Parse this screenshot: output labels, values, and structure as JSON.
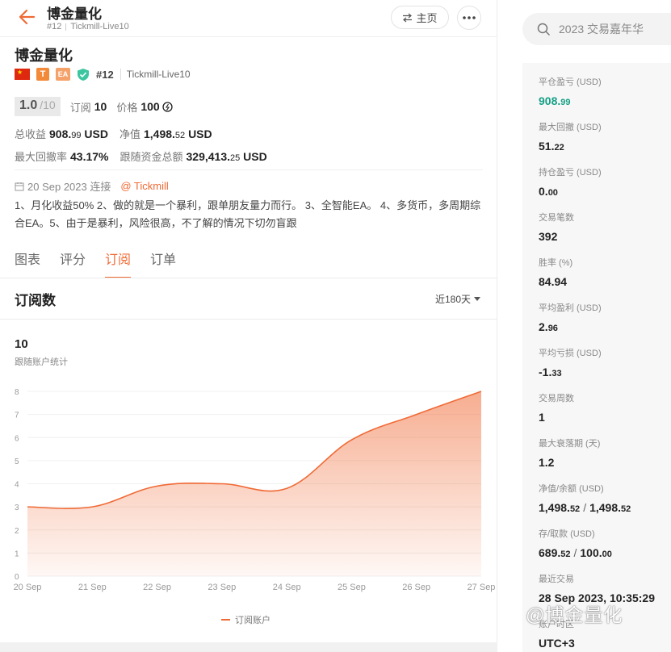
{
  "header": {
    "title": "博金量化",
    "rank": "#12",
    "server": "Tickmill-Live10",
    "home_label": "主页"
  },
  "profile": {
    "name": "博金量化",
    "flag_glyph": "★",
    "badge_t": "T",
    "badge_ea": "EA",
    "rank": "#12",
    "server": "Tickmill-Live10",
    "rating": "1.0",
    "rating_max": "/10",
    "subscribe_label": "订阅",
    "subscribe_count": "10",
    "price_label": "价格",
    "price_value": "100",
    "total_profit_label": "总收益",
    "total_profit_int": "908.",
    "total_profit_dec": "99",
    "total_profit_unit": "USD",
    "equity_label": "净值",
    "equity_int": "1,498.",
    "equity_dec": "52",
    "equity_unit": "USD",
    "max_drawdown_label": "最大回撤率",
    "max_drawdown_value": "43.17%",
    "follow_funds_label": "跟随资金总额",
    "follow_funds_int": "329,413.",
    "follow_funds_dec": "25",
    "follow_funds_unit": "USD",
    "connect_date": "20 Sep 2023 连接",
    "connect_broker": "@ Tickmill",
    "description": "1、月化收益50% 2、做的就是一个暴利，跟单朋友量力而行。 3、全智能EA。 4、多货币，多周期综合EA。5、由于是暴利，风险很高，不了解的情况下切勿盲跟"
  },
  "tabs": [
    {
      "label": "图表",
      "active": false
    },
    {
      "label": "评分",
      "active": false
    },
    {
      "label": "订阅",
      "active": true
    },
    {
      "label": "订单",
      "active": false
    }
  ],
  "subscriptions": {
    "title": "订阅数",
    "range": "近180天",
    "current_count": "10",
    "current_label": "跟随账户统计",
    "legend": "订阅账户"
  },
  "chart_data": {
    "type": "area",
    "x": [
      "20 Sep",
      "21 Sep",
      "22 Sep",
      "23 Sep",
      "24 Sep",
      "25 Sep",
      "26 Sep",
      "27 Sep"
    ],
    "series": [
      {
        "name": "订阅账户",
        "values": [
          3,
          3,
          3.9,
          4,
          3.8,
          5.9,
          7,
          8
        ]
      }
    ],
    "yticks": [
      0,
      1,
      2,
      3,
      4,
      5,
      6,
      7,
      8
    ],
    "ylim": [
      0,
      8
    ],
    "grid": true,
    "legend_position": "bottom",
    "color": "#f06a35"
  },
  "search": {
    "placeholder": "2023 交易嘉年华"
  },
  "metrics": [
    {
      "label": "平仓盈亏 (USD)",
      "int": "908.",
      "dec": "99",
      "green": true
    },
    {
      "label": "最大回撤 (USD)",
      "int": "51.",
      "dec": "22"
    },
    {
      "label": "持仓盈亏 (USD)",
      "int": "0.",
      "dec": "00"
    },
    {
      "label": "交易笔数",
      "int": "392",
      "dec": ""
    },
    {
      "label": "胜率 (%)",
      "int": "84.94",
      "dec": ""
    },
    {
      "label": "平均盈利 (USD)",
      "int": "2.",
      "dec": "96"
    },
    {
      "label": "平均亏损 (USD)",
      "int": "-1.",
      "dec": "33"
    },
    {
      "label": "交易周数",
      "int": "1",
      "dec": ""
    },
    {
      "label": "最大衰落期 (天)",
      "int": "1.2",
      "dec": ""
    },
    {
      "label": "净值/余额 (USD)",
      "int": "1,498.",
      "dec": "52",
      "int2": "1,498.",
      "dec2": "52"
    },
    {
      "label": "存/取款 (USD)",
      "int": "689.",
      "dec": "52",
      "int2": "100.",
      "dec2": "00"
    },
    {
      "label": "最近交易",
      "int": "28 Sep 2023, 10:35:29",
      "dec": ""
    },
    {
      "label": "账户时区",
      "int": "UTC+3",
      "dec": ""
    }
  ],
  "watermark": "@博金量化"
}
